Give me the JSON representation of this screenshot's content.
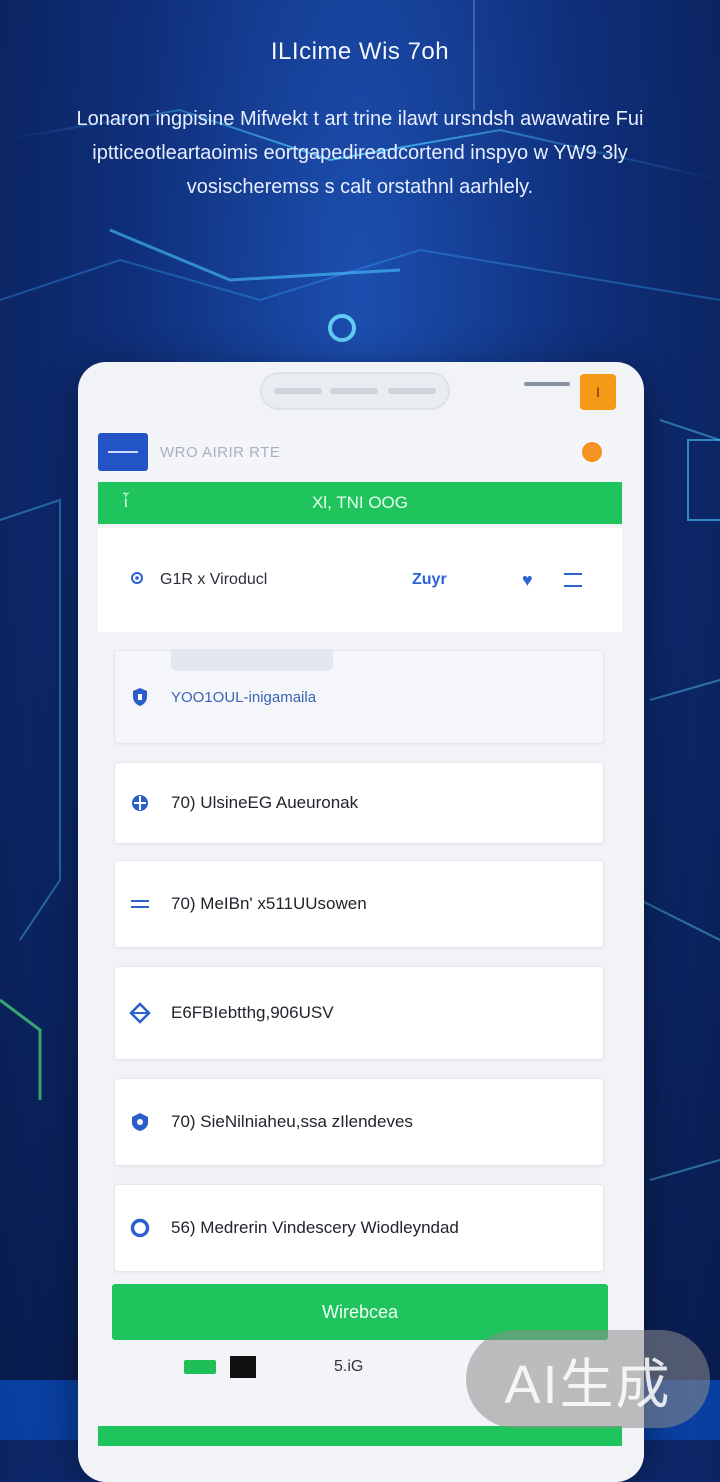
{
  "hero": {
    "title": "ILIcime Wis 7oh",
    "description": "Lonaron ingpisine Mifwekt t art trine ilawt ursndsh awawatire Fui iptticeotleartaoimis eortgapedireadcortend inspyo w YW9 3ly vosischeremss s calt orstathnl aarhlely."
  },
  "status_bar": {
    "badge": "I"
  },
  "app_header": {
    "title": "WRO AIRIR RTE"
  },
  "banner": {
    "left_mark": "ἷ",
    "text": "Xl, TNI OOG"
  },
  "info_card": {
    "title": "G1R x Viroducl",
    "link": "Zuyr"
  },
  "list_items": [
    {
      "text": "YOO1OUL-inigamaila",
      "icon": "shield-icon"
    },
    {
      "text": "70) UlsineEG Aueuronak",
      "icon": "globe-icon"
    },
    {
      "text": "70) MeIBn' x511UUsowen",
      "icon": "lines-icon"
    },
    {
      "text": "E6FBIebtthg,906USV",
      "icon": "diamond-icon"
    },
    {
      "text": "70) SieNilniaheu,ssa zIlendeves",
      "icon": "badge-icon"
    },
    {
      "text": "56) Medrerin Vindescery Wiodleyndad",
      "icon": "ring-icon"
    }
  ],
  "cta": {
    "label": "Wirebcea"
  },
  "bottom_bar": {
    "label": "5.iG"
  },
  "watermark": {
    "text": "AI生成"
  },
  "colors": {
    "primary_green": "#1fc45c",
    "primary_blue": "#2354c7",
    "accent_orange": "#f59a17",
    "background_navy": "#0f2f7a"
  }
}
